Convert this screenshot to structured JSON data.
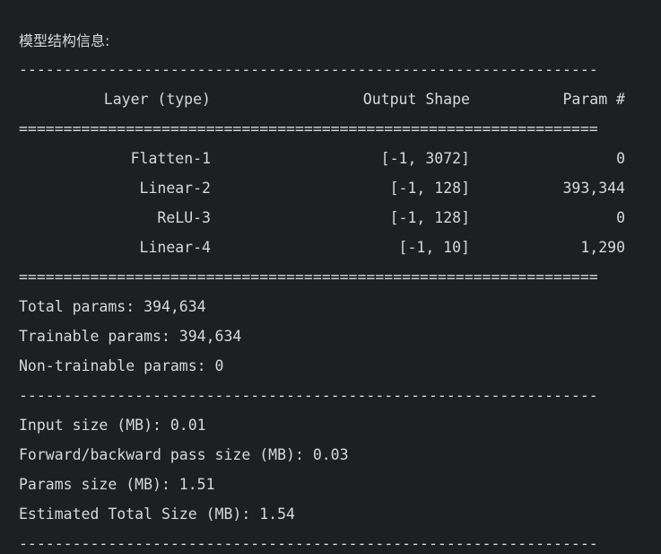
{
  "title": "模型结构信息:",
  "separators": {
    "dash": "-----------------------------------------------------------------",
    "equals": "================================================================="
  },
  "header": {
    "layer": "Layer (type)",
    "shape": "Output Shape",
    "param": "Param #"
  },
  "rows": [
    {
      "layer": "Flatten-1",
      "shape": "[-1, 3072]",
      "param": "0"
    },
    {
      "layer": "Linear-2",
      "shape": "[-1, 128]",
      "param": "393,344"
    },
    {
      "layer": "ReLU-3",
      "shape": "[-1, 128]",
      "param": "0"
    },
    {
      "layer": "Linear-4",
      "shape": "[-1, 10]",
      "param": "1,290"
    }
  ],
  "params_summary": [
    "Total params: 394,634",
    "Trainable params: 394,634",
    "Non-trainable params: 0"
  ],
  "size_summary": [
    "Input size (MB): 0.01",
    "Forward/backward pass size (MB): 0.03",
    "Params size (MB): 1.51",
    "Estimated Total Size (MB): 1.54"
  ]
}
